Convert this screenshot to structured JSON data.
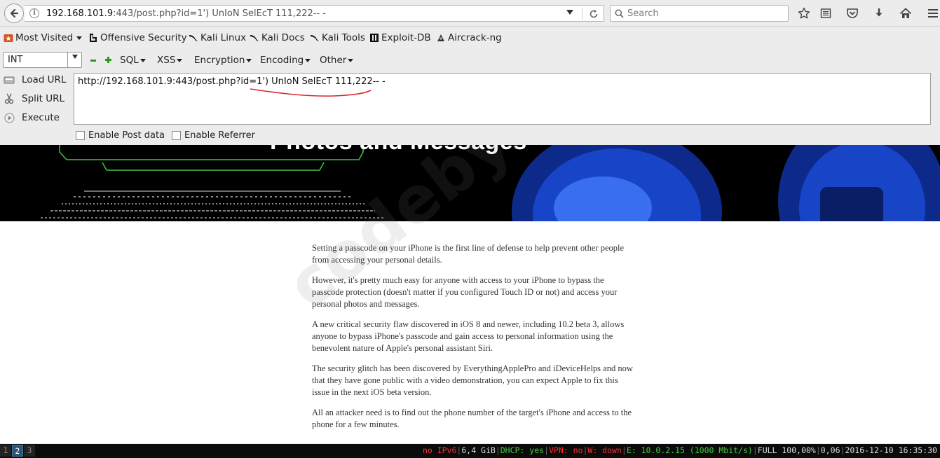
{
  "browser": {
    "url_host": "192.168.101.9",
    "url_rest": ":443/post.php?id=1') UnIoN SelEcT 111,222-- -",
    "search_placeholder": "Search"
  },
  "bookmarks": [
    {
      "label": "Most Visited",
      "icon": "star-folder-icon",
      "has_caret": true
    },
    {
      "label": "Offensive Security",
      "icon": "offsec-icon"
    },
    {
      "label": "Kali Linux",
      "icon": "kali-dragon-icon"
    },
    {
      "label": "Kali Docs",
      "icon": "kali-dragon-icon"
    },
    {
      "label": "Kali Tools",
      "icon": "kali-dragon-icon"
    },
    {
      "label": "Exploit-DB",
      "icon": "exploitdb-icon"
    },
    {
      "label": "Aircrack-ng",
      "icon": "aircrack-icon"
    }
  ],
  "hackbar": {
    "select_value": "INT",
    "menus": [
      "SQL",
      "XSS",
      "Encryption",
      "Encoding",
      "Other"
    ],
    "actions": [
      "Load URL",
      "Split URL",
      "Execute"
    ],
    "url_value": "http://192.168.101.9:443/post.php?id=1') UnIoN SelEcT 111,222-- -",
    "checkbox_post": "Enable Post data",
    "checkbox_referrer": "Enable Referrer"
  },
  "page": {
    "banner_title": "Photos and Messages",
    "watermark": "codeby.net",
    "paragraphs": [
      "Setting a passcode on your iPhone is the first line of defense to help prevent other people from accessing your personal details.",
      "However, it's pretty much easy for anyone with access to your iPhone to bypass the passcode protection (doesn't matter if you configured Touch ID or not) and access your personal photos and messages.",
      "A new critical security flaw discovered in iOS 8 and newer, including 10.2 beta 3, allows anyone to bypass iPhone's passcode and gain access to personal information using the benevolent nature of Apple's personal assistant Siri.",
      "The security glitch has been discovered by EverythingApplePro and iDeviceHelps and now that they have gone public with a video demonstration, you can expect Apple to fix this issue in the next iOS beta version.",
      "All an attacker need is to find out the phone number of the target's iPhone and access to the phone for a few minutes."
    ]
  },
  "statusbar": {
    "workspaces": [
      "1",
      "2",
      "3"
    ],
    "active_workspace": "2",
    "ipv6": "no IPv6",
    "memory": "6,4 GiB",
    "dhcp": "DHCP: yes",
    "vpn": "VPN: no",
    "wireless": "W: down",
    "ethernet": "E: 10.0.2.15 (1000 Mbit/s)",
    "battery": "FULL 100,00%",
    "load": "0,06",
    "datetime": "2016-12-10 16:35:30"
  },
  "colors": {
    "red": "#ff3030",
    "green": "#40d040",
    "accent": "#285577"
  }
}
